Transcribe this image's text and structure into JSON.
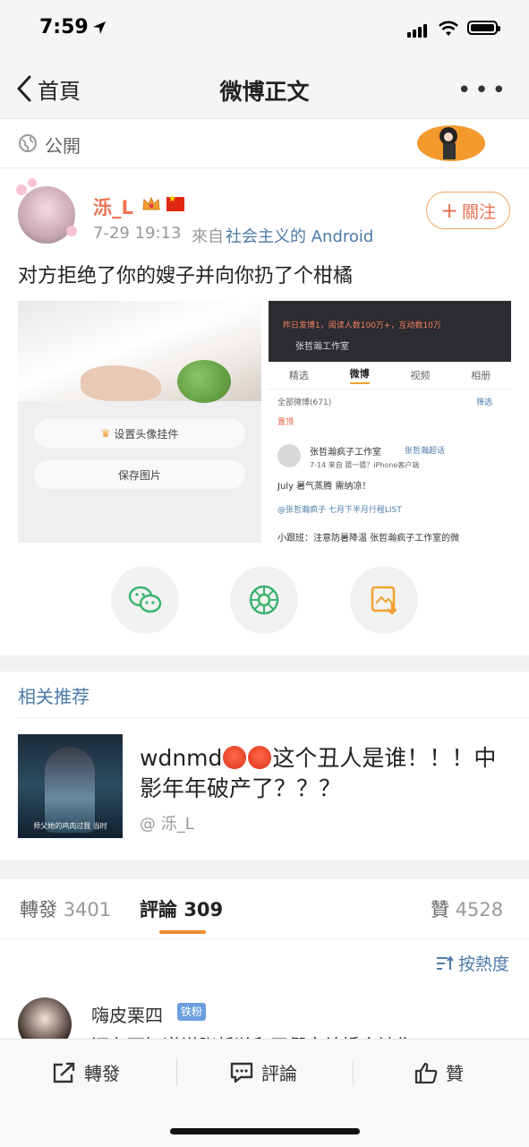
{
  "status_bar": {
    "time": "7:59"
  },
  "nav": {
    "back_label": "首頁",
    "title": "微博正文",
    "more": "•••"
  },
  "visibility": {
    "label": "公開"
  },
  "post": {
    "username": "泺_L",
    "time": "7-29 19:13",
    "source_prefix": "來自",
    "source": "社会主义的 Android",
    "follow_label": "關注",
    "text": "对方拒绝了你的嫂子并向你扔了个柑橘",
    "image_left": {
      "button1": "设置头像挂件",
      "button2": "保存图片"
    },
    "image_right": {
      "stats": "昨日发博1，阅读人数100万+，互动数10万",
      "studio": "张哲瀚工作室",
      "tabs": [
        "精选",
        "微博",
        "视频",
        "相册"
      ],
      "all_weibo": "全部微博(671)",
      "filter": "筛选",
      "pinned": "置顶",
      "author": "张哲瀚疯子工作室",
      "author_tag": "张哲瀚超话",
      "meta": "7-14  来自 猜一猜？iPhone客户端",
      "line1": "July 暑气蒸腾 需纳凉！",
      "line2": "@张哲瀚疯子 七月下半月行程LIST",
      "line3": "小跟班：注意防暑降温 张哲瀚疯子工作室的微"
    }
  },
  "share_actions": [
    {
      "name": "wechat",
      "color": "#3bb46e"
    },
    {
      "name": "moments",
      "color": "#3bb46e"
    },
    {
      "name": "save-image",
      "color": "#f0a030"
    }
  ],
  "recommend": {
    "title": "相关推荐",
    "thumb_caption": "师父她的鸡肉过我 当时",
    "text_part1": "wdnmd",
    "text_part2": "这个丑人是谁！！！中影年年破产了？？？",
    "author": "@ 泺_L"
  },
  "tabs": {
    "repost_label": "轉發",
    "repost_count": "3401",
    "comment_label": "評論",
    "comment_count": "309",
    "like_label": "贊",
    "like_count": "4528"
  },
  "sort_label": "按熱度",
  "comment": {
    "name": "嗨皮栗四",
    "badge": "铁粉",
    "text": "还有不知道说张哲瀚和王僴文结婚会被告！"
  },
  "bottom_bar": {
    "repost": "轉發",
    "comment": "評論",
    "like": "贊"
  }
}
